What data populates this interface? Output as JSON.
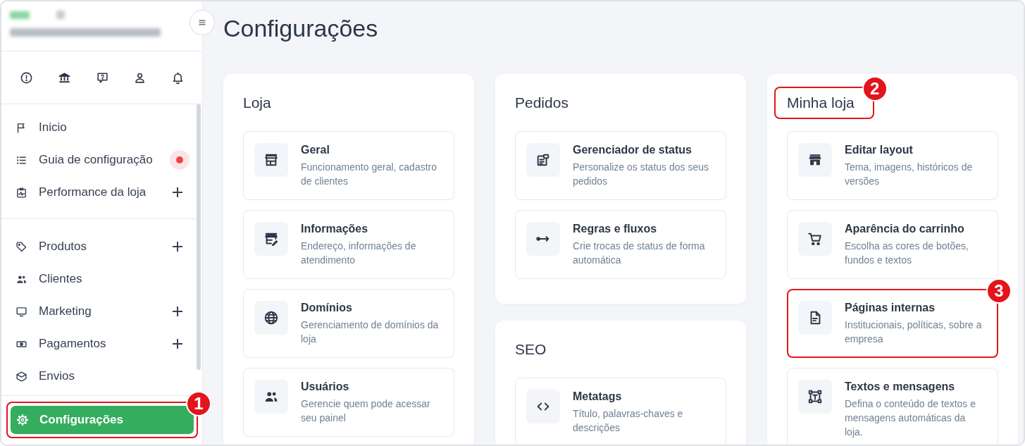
{
  "sidebar": {
    "nav_groups": [
      {
        "items": [
          {
            "label": "Inicio",
            "selected": false,
            "expandable": false,
            "notification": false
          },
          {
            "label": "Guia de configuração",
            "selected": false,
            "expandable": false,
            "notification": true
          },
          {
            "label": "Performance da loja",
            "selected": false,
            "expandable": true,
            "notification": false
          }
        ]
      },
      {
        "items": [
          {
            "label": "Produtos",
            "selected": false,
            "expandable": true,
            "notification": false
          },
          {
            "label": "Clientes",
            "selected": false,
            "expandable": false,
            "notification": false
          },
          {
            "label": "Marketing",
            "selected": false,
            "expandable": true,
            "notification": false
          },
          {
            "label": "Pagamentos",
            "selected": false,
            "expandable": true,
            "notification": false
          },
          {
            "label": "Envios",
            "selected": false,
            "expandable": false,
            "notification": false
          }
        ]
      }
    ],
    "footer_button": {
      "label": "Configurações",
      "selected": true,
      "callout": "1"
    }
  },
  "page_title": "Configurações",
  "columns": [
    {
      "sections": [
        {
          "title": "Loja",
          "items": [
            {
              "title": "Geral",
              "description": "Funcionamento geral, cadastro de clientes"
            },
            {
              "title": "Informações",
              "description": "Endereço, informações de atendimento"
            },
            {
              "title": "Domínios",
              "description": "Gerenciamento de domínios da loja"
            },
            {
              "title": "Usuários",
              "description": "Gerencie quem pode acessar seu painel"
            }
          ]
        }
      ]
    },
    {
      "sections": [
        {
          "title": "Pedidos",
          "items": [
            {
              "title": "Gerenciador de status",
              "description": "Personalize os status dos seus pedidos"
            },
            {
              "title": "Regras e fluxos",
              "description": "Crie trocas de status de forma automática"
            }
          ]
        },
        {
          "title": "SEO",
          "items": [
            {
              "title": "Metatags",
              "description": "Título, palavras-chaves e descrições"
            }
          ]
        }
      ]
    },
    {
      "sections": [
        {
          "title": "Minha loja",
          "callout": "2",
          "items": [
            {
              "title": "Editar layout",
              "description": "Tema, imagens, históricos de versões"
            },
            {
              "title": "Aparência do carrinho",
              "description": "Escolha as cores de botões, fundos e textos"
            },
            {
              "title": "Páginas internas",
              "description": "Institucionais, políticas, sobre a empresa",
              "callout": "3"
            },
            {
              "title": "Textos e mensagens",
              "description": "Defina o conteúdo de textos e mensagens automáticas da loja."
            }
          ]
        }
      ]
    }
  ]
}
